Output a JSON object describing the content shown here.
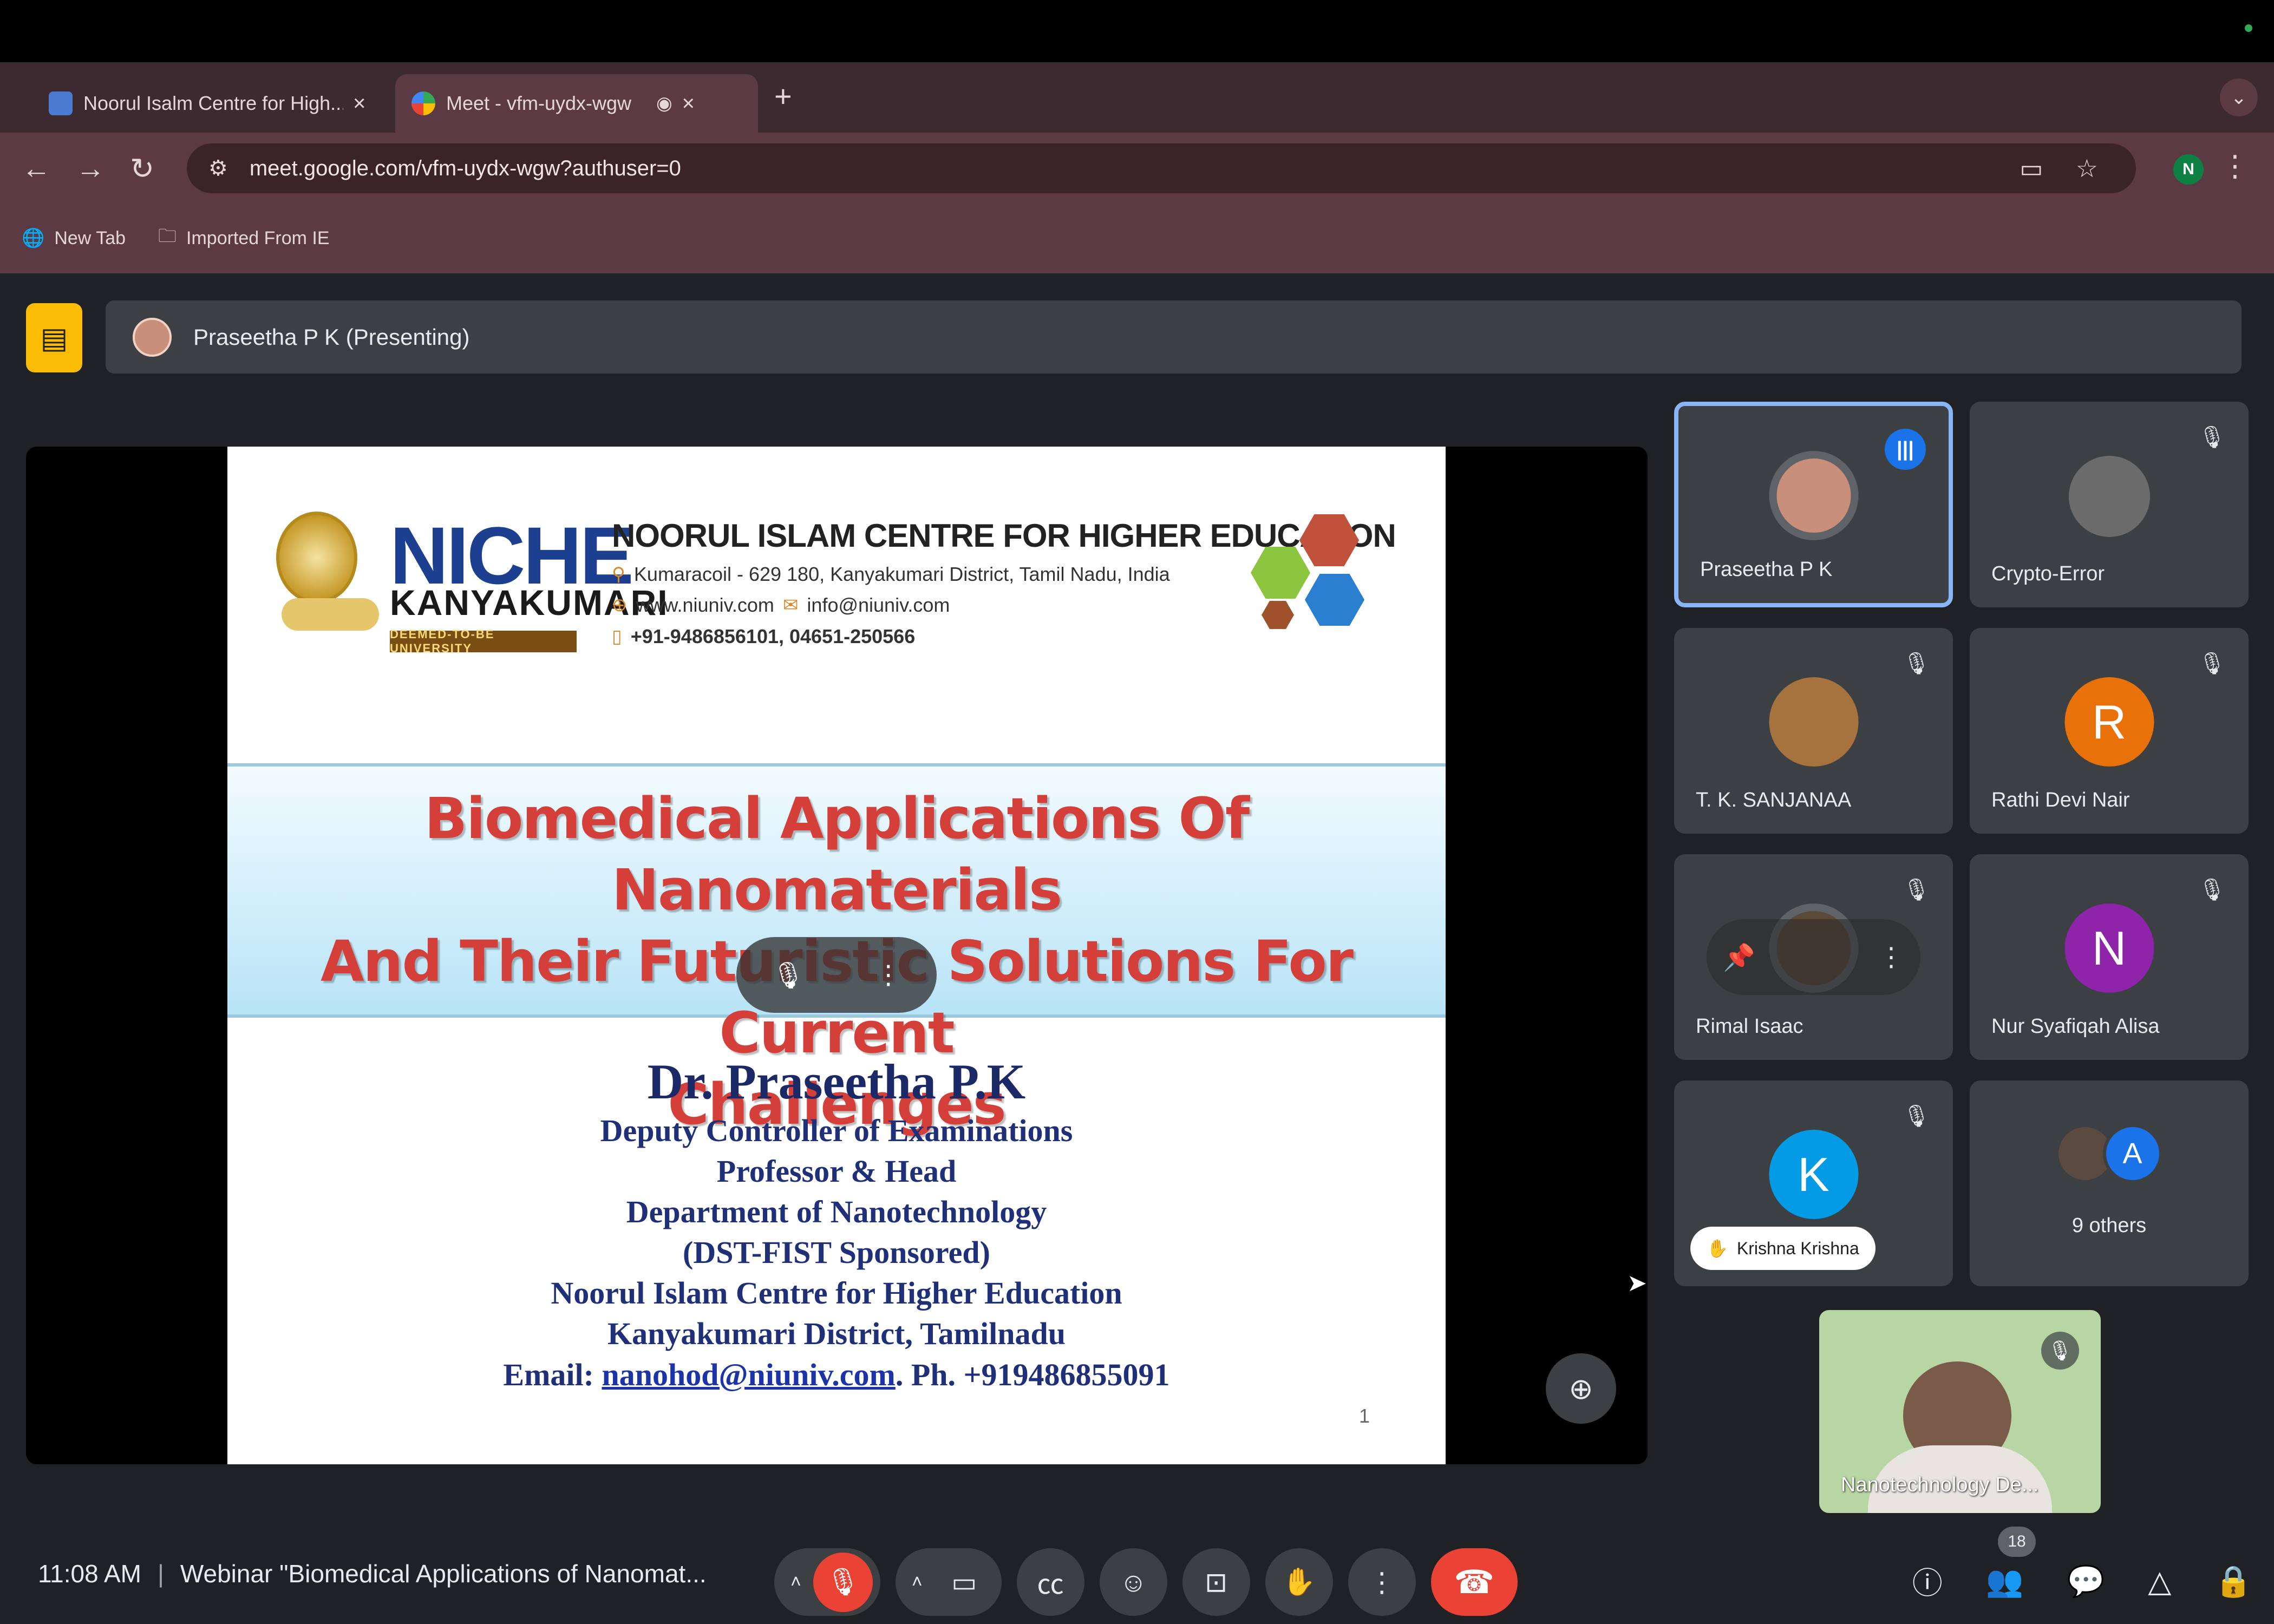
{
  "browser": {
    "tabs": [
      {
        "label": "Noorul Isalm Centre for High...",
        "close": "×"
      },
      {
        "label": "Meet - vfm-uydx-wgw",
        "close": "×"
      }
    ],
    "new_tab": "+",
    "url": "meet.google.com/vfm-uydx-wgw?authuser=0",
    "profile_initial": "N",
    "bookmarks": [
      "New Tab",
      "Imported From IE"
    ]
  },
  "presenting": {
    "label": "Praseetha P K (Presenting)"
  },
  "slide": {
    "logo_text": "NICHE",
    "logo_sub": "KANYAKUMARI",
    "logo_tag": "DEEMED-TO-BE UNIVERSITY",
    "institution": "NOORUL ISLAM CENTRE FOR HIGHER EDUCATION",
    "address": "Kumaracoil - 629 180, Kanyakumari District, Tamil Nadu, India",
    "web": "www.niuniv.com",
    "email_contact": "info@niuniv.com",
    "phone": "+91-9486856101, 04651-250566",
    "title_lines": [
      "Biomedical Applications Of Nanomaterials",
      "And Their Futuristic Solutions For Current",
      "Challenges"
    ],
    "presenter_name": "Dr. Praseetha P.K",
    "presenter_lines": [
      "Deputy Controller of  Examinations",
      "Professor & Head",
      "Department of  Nanotechnology",
      "(DST-FIST Sponsored)",
      "Noorul Islam Centre for Higher Education",
      "Kanyakumari District, Tamilnadu"
    ],
    "email_label": "Email: ",
    "email": "nanohod@niuniv.com",
    "phone_line": ". Ph. +919486855091",
    "page": "1"
  },
  "participants": [
    {
      "name": "Praseetha P K",
      "speaking": true
    },
    {
      "name": "Crypto-Error",
      "muted": true
    },
    {
      "name": "T. K. SANJANAA",
      "muted": true
    },
    {
      "name": "Rathi Devi Nair",
      "initial": "R",
      "color": "#e8710a",
      "muted": true
    },
    {
      "name": "Rimal Isaac",
      "muted": true
    },
    {
      "name": "Nur Syafiqah Alisa",
      "initial": "N",
      "color": "#8e24aa",
      "muted": true
    },
    {
      "name": "Krishna Krishna",
      "initial": "K",
      "color": "#039be5",
      "muted": true,
      "hand_raised": true
    },
    {
      "name": "9 others",
      "initial": "A",
      "color": "#1a73e8"
    }
  ],
  "self_view": {
    "name": "Nanotechnology De..."
  },
  "bottom": {
    "time": "11:08 AM",
    "separator": "|",
    "meeting_title": "Webinar \"Biomedical Applications of Nanomat...",
    "people_count": "18"
  },
  "colors": {
    "accent": "#8ab4f8",
    "hangup": "#ea4335",
    "present_badge": "#fbbc04",
    "tile_bg": "#3c4043",
    "meet_bg": "#202124"
  }
}
